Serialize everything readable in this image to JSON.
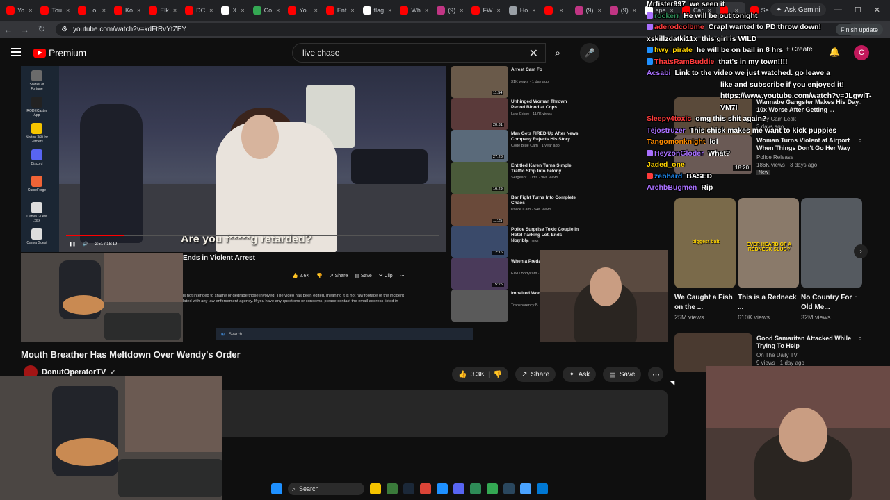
{
  "browser": {
    "tabs": [
      {
        "label": "Yo",
        "color": "#ff0000"
      },
      {
        "label": "Tou",
        "color": "#ff0000"
      },
      {
        "label": "Lo!",
        "color": "#ff0000"
      },
      {
        "label": "Ko",
        "color": "#ff0000"
      },
      {
        "label": "Elk",
        "color": "#ff0000"
      },
      {
        "label": "DC",
        "color": "#ff0000"
      },
      {
        "label": "X",
        "color": "#ffffff"
      },
      {
        "label": "Co",
        "color": "#34a853"
      },
      {
        "label": "You",
        "color": "#ff0000"
      },
      {
        "label": "Ent",
        "color": "#ff0000"
      },
      {
        "label": "flag",
        "color": "#ffffff"
      },
      {
        "label": "Wh",
        "color": "#ff0000"
      },
      {
        "label": "(9)",
        "color": "#c13584"
      },
      {
        "label": "FW",
        "color": "#ff0000"
      },
      {
        "label": "Ho",
        "color": "#9aa0a6"
      },
      {
        "label": "",
        "color": "#ff0000"
      },
      {
        "label": "(9)",
        "color": "#c13584"
      },
      {
        "label": "(9)",
        "color": "#c13584"
      },
      {
        "label": "spe",
        "color": "#ffffff"
      },
      {
        "label": "Car",
        "color": "#ff0000"
      },
      {
        "label": "",
        "color": "#ff0000",
        "active": true
      },
      {
        "label": "Se",
        "color": "#ff0000"
      }
    ],
    "ask_gemini": "Ask Gemini",
    "url": "youtube.com/watch?v=kdFtRvYtZEY",
    "finish_update": "Finish update"
  },
  "youtube": {
    "premium_label": "Premium",
    "search_value": "live chase",
    "create_label": "+ Create",
    "avatar_letter": "C"
  },
  "desktop_icons": [
    {
      "label": "Soldier of Fortune",
      "color": "#6b6b6b"
    },
    {
      "label": "RODECaster App",
      "color": "#222"
    },
    {
      "label": "Norton 360 for Gamers",
      "color": "#f5c400"
    },
    {
      "label": "Discord",
      "color": "#5865f2"
    },
    {
      "label": "CurseForge",
      "color": "#f16436"
    },
    {
      "label": "Canva Guest .xlsx",
      "color": "#ddd"
    },
    {
      "label": "Canva Guest",
      "color": "#ddd"
    }
  ],
  "captured": {
    "caption": "Are you f*****g retarded?",
    "time": "2:51 / 18:19",
    "title": "Ends in Violent Arrest",
    "likes": "2.6K",
    "share": "Share",
    "save": "Save",
    "clip": "Clip",
    "desc_line1": "is not intended to shame or degrade those involved. The video has been edited, meaning it is not raw footage of the incident",
    "desc_line2": "lated with any law enforcement agency. If you have any questions or concerns, please contact the email address listed in",
    "taskbar_search": "Search",
    "side_videos": [
      {
        "title": "Arrest Cam Fo",
        "meta": "31K views · 1 day ago",
        "dur": "11:54",
        "color": "#6a5a4a"
      },
      {
        "title": "Unhinged Woman Thrown Period Blood at Cops",
        "meta": "Law Crime · 117K views",
        "dur": "20:31",
        "color": "#5a3a3a"
      },
      {
        "title": "Man Gets FIRED Up After News Company Rejects His Story",
        "meta": "Code Blue Cam · 1 year ago",
        "dur": "27:28",
        "color": "#5a6a7a"
      },
      {
        "title": "Entitled Karen Turns Simple Traffic Stop Into Felony",
        "meta": "Sergeant Curtis · 96K views",
        "dur": "16:29",
        "color": "#4a5a3a"
      },
      {
        "title": "Bar Fight Turns Into Complete Chaos",
        "meta": "Police Cam · 54K views",
        "dur": "11:25",
        "color": "#6a4a3a"
      },
      {
        "title": "Police Surprise Toxic Couple in Hotel Parking Lot, Ends Horribly",
        "meta": "Body Cam Tube",
        "dur": "12:16",
        "color": "#3a4a6a"
      },
      {
        "title": "When a Preda the Act",
        "meta": "EWU Bodycam · 403K views",
        "dur": "15:25",
        "color": "#4a3a5a"
      },
      {
        "title": "Impaired Won her Mom's Jee",
        "meta": "Transparency B",
        "dur": "",
        "color": "#5a5a5a"
      }
    ]
  },
  "main": {
    "title": "Mouth Breather Has Meltdown Over Wendy's Order",
    "channel": "DonutOperatorTV",
    "likes": "3.3K",
    "share": "Share",
    "ask": "Ask",
    "save": "Save"
  },
  "suggestions": [
    {
      "title": "Wannabe Gangster Makes His Day 10x Worse After Getting ...",
      "channel": "Body Cam Leak",
      "views": "3 days ago",
      "dur": "",
      "color": "#5a4a3a",
      "new": false
    },
    {
      "title": "Woman Turns Violent at Airport When Things Don't Go Her Way",
      "channel": "Police Release",
      "views": "186K views · 3 days ago",
      "dur": "18:20",
      "color": "#6a5a55",
      "new": true
    },
    {
      "title": "Good Samaritan Attacked While Trying To Help",
      "channel": "On The Daily TV",
      "views": "9 views · 1 day ago",
      "dur": "",
      "color": "#4a3a30",
      "new": false
    }
  ],
  "shorts": [
    {
      "label": "biggest bait",
      "title": "We Caught a Fish on the ...",
      "views": "25M views",
      "color": "#7a6a4a"
    },
    {
      "label": "EVER HEARD OF A REDNECK SLUG?",
      "title": "This is a Redneck ...",
      "views": "610K views",
      "color": "#8a7a6a"
    },
    {
      "label": "",
      "title": "No Country For Old Me...",
      "views": "32M views",
      "color": "#555a60"
    }
  ],
  "chat": [
    {
      "user": "Mrfister997",
      "text": "we seen it",
      "color": "#ffffff",
      "badge": ""
    },
    {
      "user": "rockerr",
      "text": "He will be out tonight",
      "color": "#2e8b57",
      "badge": "#a970ff"
    },
    {
      "user": "aderodcolbme",
      "text": "Crap! wanted to PD throw down!",
      "color": "#ff3b3b",
      "badge": "#a970ff"
    },
    {
      "user": "xskillzdatki11x",
      "text": "this girl is WILD",
      "color": "#ffffff",
      "badge": ""
    },
    {
      "user": "hwy_pirate",
      "text": "he will be on bail in 8 hrs",
      "color": "#ffd400",
      "badge": "#1e90ff"
    },
    {
      "user": "ThatsRamBuddie",
      "text": "that's in my town!!!!",
      "color": "#ff3b3b",
      "badge": "#1e90ff"
    },
    {
      "user": "Acsabi",
      "text": "Link to the video we just watched. go leave a",
      "color": "#a970ff",
      "badge": ""
    },
    {
      "user": "",
      "text": "like and subscribe if you enjoyed it!",
      "color": "#ffffff",
      "badge": ""
    },
    {
      "user": "",
      "text": "https://www.youtube.com/watch?v=JLgwiT-",
      "color": "#ffffff",
      "badge": ""
    },
    {
      "user": "",
      "text": "VM7I",
      "color": "#ffffff",
      "badge": ""
    },
    {
      "user": "Sleepy4toxic",
      "text": "omg this shit again?",
      "color": "#ff3b3b",
      "badge": ""
    },
    {
      "user": "Tejostruzer",
      "text": "This chick makes me want to kick puppies",
      "color": "#a970ff",
      "badge": ""
    },
    {
      "user": "Tangomonknight",
      "text": "lol",
      "color": "#ff8c00",
      "badge": ""
    },
    {
      "user": "HeyzonGloder",
      "text": "What?",
      "color": "#a970ff",
      "badge": "#a970ff"
    },
    {
      "user": "Jaded_one",
      "text": "",
      "color": "#ffd400",
      "badge": ""
    },
    {
      "user": "zebhard",
      "text": "BASED",
      "color": "#1e90ff",
      "badge": "#ff3b3b"
    },
    {
      "user": "ArchbBugmen",
      "text": "Rip",
      "color": "#a970ff",
      "badge": ""
    }
  ],
  "taskbar": {
    "search": "Search"
  }
}
